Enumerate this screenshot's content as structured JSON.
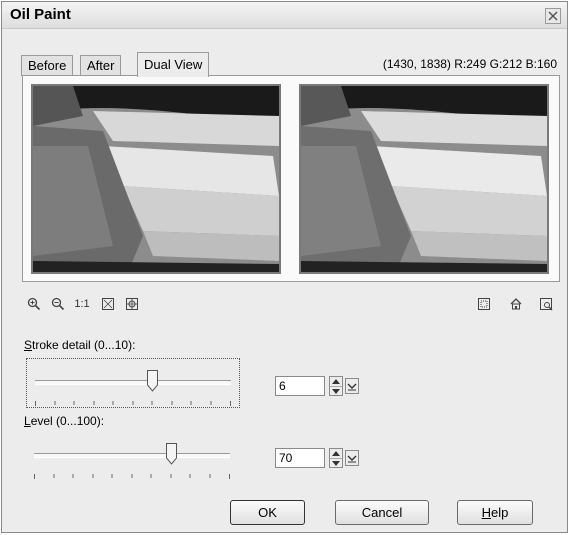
{
  "window": {
    "title": "Oil Paint"
  },
  "tabs": [
    {
      "label": "Before"
    },
    {
      "label": "After"
    },
    {
      "label": "Dual View"
    }
  ],
  "active_tab": "Dual View",
  "pixel_readout": "(1430, 1838) R:249 G:212 B:160",
  "toolbar": {
    "one_to_one_label": "1:1"
  },
  "stroke_detail": {
    "accel": "S",
    "label_rest": "troke detail (0...10):",
    "value": "6",
    "min": 0,
    "max": 10
  },
  "level": {
    "accel": "L",
    "label_rest": "evel (0...100):",
    "value": "70",
    "min": 0,
    "max": 100
  },
  "buttons": {
    "ok": "OK",
    "cancel": "Cancel",
    "help_accel": "H",
    "help_rest": "elp"
  },
  "icons": [
    "zoom-in-icon",
    "zoom-out-icon",
    "fit-window-icon",
    "pan-icon",
    "preview-icon",
    "reset-icon",
    "proof-icon",
    "close-icon",
    "spin-up-icon",
    "spin-down-icon",
    "dropdown-icon"
  ]
}
